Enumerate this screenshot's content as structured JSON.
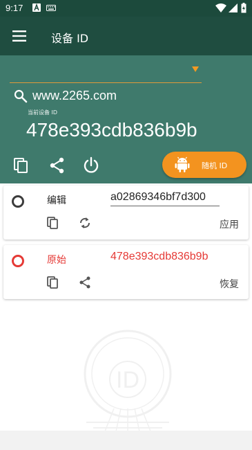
{
  "status_bar": {
    "time": "9:17"
  },
  "app_bar": {
    "title": "设备 ID"
  },
  "header": {
    "dropdown_value": "",
    "search_text": "www.2265.com",
    "current_label": "当前设备 ID",
    "current_id": "478e393cdb836b9b",
    "random_button_label": "随机 ID"
  },
  "cards": [
    {
      "label": "编辑",
      "value": "a02869346bf7d300",
      "action": "应用"
    },
    {
      "label": "原始",
      "value": "478e393cdb836b9b",
      "action": "恢复"
    }
  ],
  "watermark": {
    "text": "ID"
  },
  "colors": {
    "statusbar": "#1c4a3c",
    "appbar": "#1f4d40",
    "header": "#3f7a6c",
    "accent": "#f3931f",
    "original_red": "#e53935"
  }
}
